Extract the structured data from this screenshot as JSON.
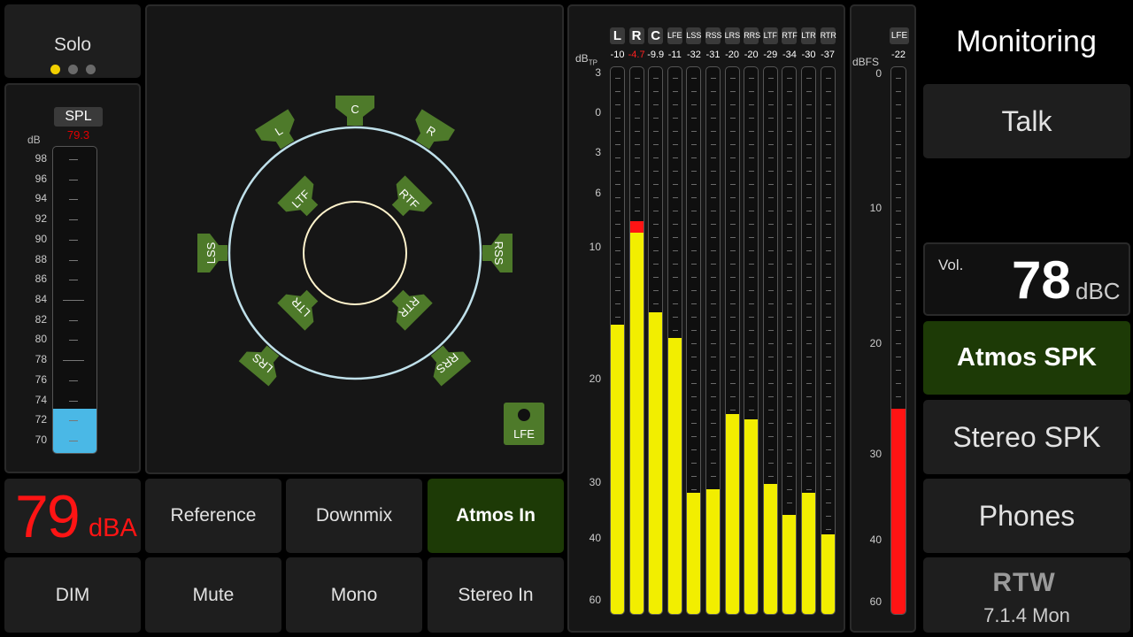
{
  "solo": {
    "label": "Solo",
    "page_dots": 3,
    "active_dot": 0
  },
  "spl": {
    "badge": "SPL",
    "peak": "79.3",
    "unit": "dB",
    "scale": [
      "98",
      "96",
      "94",
      "92",
      "90",
      "88",
      "86",
      "84",
      "82",
      "80",
      "78",
      "76",
      "74",
      "72",
      "70"
    ],
    "level_db": 73,
    "fill_color": "#4ab8e6"
  },
  "dba": {
    "value": "79",
    "unit": "dBA",
    "color": "#ff1414"
  },
  "speakers": {
    "outer": [
      "L",
      "C",
      "R",
      "LSS",
      "RSS",
      "LRS",
      "RRS"
    ],
    "inner": [
      "LTF",
      "RTF",
      "LTR",
      "RTR"
    ],
    "lfe": "LFE",
    "speaker_color": "#4e7a2a",
    "outer_ring_color": "#bfe0ea",
    "inner_ring_color": "#fff3cc"
  },
  "buttons": {
    "reference": "Reference",
    "downmix": "Downmix",
    "atmos_in": "Atmos In",
    "dim": "DIM",
    "mute": "Mute",
    "mono": "Mono",
    "stereo_in": "Stereo In"
  },
  "truepeak": {
    "unit": "dB",
    "unit_sub": "TP",
    "scale": [
      "3",
      "0",
      "3",
      "6",
      "10",
      "20",
      "30",
      "40",
      "60"
    ],
    "channels": [
      {
        "name": "L",
        "value": "-10",
        "level_db": -16,
        "peak_db": null,
        "value_color": "#ffffff"
      },
      {
        "name": "R",
        "value": "-4.7",
        "level_db": -9,
        "peak_db": -8,
        "value_color": "#ff2020"
      },
      {
        "name": "C",
        "value": "-9.9",
        "level_db": -15,
        "peak_db": null,
        "value_color": "#ffffff"
      },
      {
        "name": "LFE",
        "value": "-11",
        "level_db": -17,
        "peak_db": null,
        "value_color": "#ffffff"
      },
      {
        "name": "LSS",
        "value": "-32",
        "level_db": -32,
        "peak_db": null,
        "value_color": "#ffffff"
      },
      {
        "name": "RSS",
        "value": "-31",
        "level_db": -31.5,
        "peak_db": null,
        "value_color": "#ffffff"
      },
      {
        "name": "LRS",
        "value": "-20",
        "level_db": -23.5,
        "peak_db": null,
        "value_color": "#ffffff"
      },
      {
        "name": "RRS",
        "value": "-20",
        "level_db": -24,
        "peak_db": null,
        "value_color": "#ffffff"
      },
      {
        "name": "LTF",
        "value": "-29",
        "level_db": -30.5,
        "peak_db": null,
        "value_color": "#ffffff"
      },
      {
        "name": "RTF",
        "value": "-34",
        "level_db": -36,
        "peak_db": null,
        "value_color": "#ffffff"
      },
      {
        "name": "LTR",
        "value": "-30",
        "level_db": -32,
        "peak_db": null,
        "value_color": "#ffffff"
      },
      {
        "name": "RTR",
        "value": "-37",
        "level_db": -39.5,
        "peak_db": null,
        "value_color": "#ffffff"
      }
    ],
    "fill_color": "#f2ee00"
  },
  "lfe_meter": {
    "name": "LFE",
    "value": "-22",
    "unit": "dBFS",
    "scale": [
      "0",
      "10",
      "20",
      "30",
      "40",
      "60"
    ],
    "level_db": -26,
    "fill_color": "#ff1414"
  },
  "right": {
    "title": "Monitoring",
    "talk": "Talk",
    "vol_label": "Vol.",
    "vol_value": "78",
    "vol_unit": "dBC",
    "atmos_spk": "Atmos SPK",
    "stereo_spk": "Stereo SPK",
    "phones": "Phones",
    "logo": "RTW",
    "preset": "7.1.4 Mon"
  }
}
